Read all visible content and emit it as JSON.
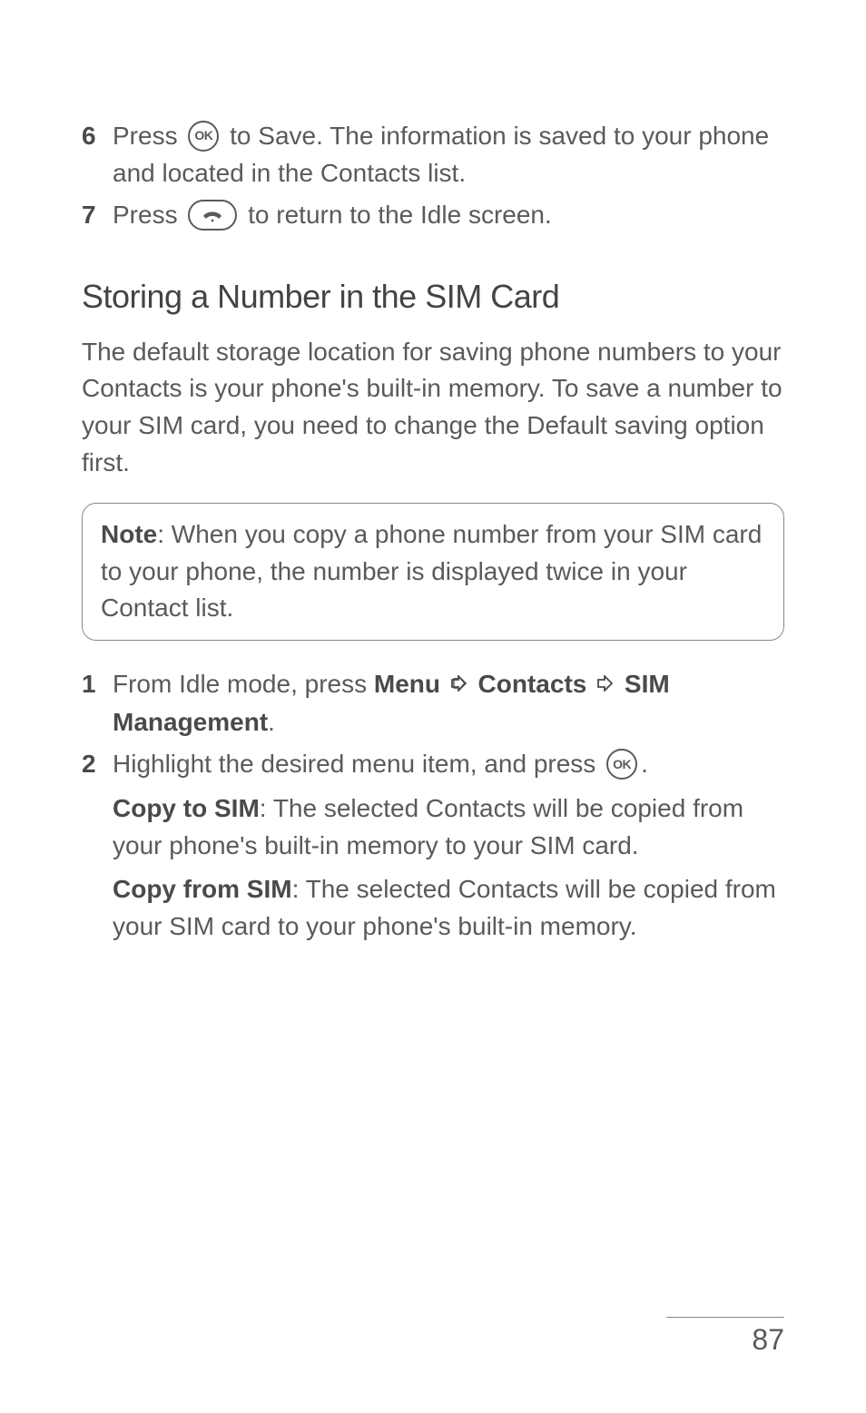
{
  "steps_top": [
    {
      "num": "6",
      "pre": "Press ",
      "icon": "ok",
      "post": " to Save. The information is saved to your phone and located in the Contacts list."
    },
    {
      "num": "7",
      "pre": "Press ",
      "icon": "end",
      "post": " to return to the Idle screen."
    }
  ],
  "heading": "Storing a Number in the SIM Card",
  "intro": "The default storage location for saving phone numbers to your Contacts is your phone's built-in memory. To save a number to your SIM card, you need to change the Default saving option first.",
  "note": {
    "label": "Note",
    "text": ": When you copy a phone number from your SIM card to your phone, the number is displayed twice in your Contact list."
  },
  "steps_bottom": {
    "s1": {
      "num": "1",
      "pre": "From Idle mode, press ",
      "menu": "Menu",
      "contacts": "Contacts",
      "sim_mgmt": "SIM Management",
      "period": "."
    },
    "s2": {
      "num": "2",
      "line1_pre": "Highlight the desired menu item, and press ",
      "line1_post": ".",
      "copy_to_label": "Copy to SIM",
      "copy_to_text": ": The selected Contacts will be copied from your phone's built-in memory to your SIM card.",
      "copy_from_label": "Copy from SIM",
      "copy_from_text": ": The selected Contacts will be copied from your SIM card to your phone's built-in memory."
    }
  },
  "page_number": "87"
}
